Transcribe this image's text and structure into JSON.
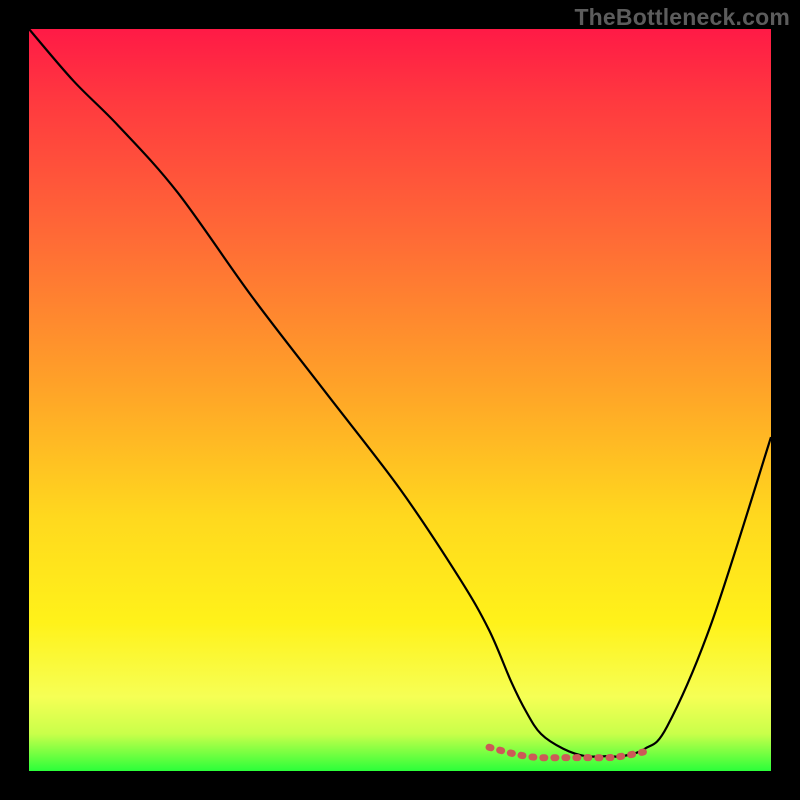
{
  "watermark": "TheBottleneck.com",
  "chart_data": {
    "type": "line",
    "title": "",
    "xlabel": "",
    "ylabel": "",
    "xlim": [
      0,
      100
    ],
    "ylim": [
      0,
      100
    ],
    "series": [
      {
        "name": "black-curve",
        "x": [
          0,
          6,
          12,
          20,
          30,
          40,
          50,
          58,
          62,
          65,
          67,
          69,
          72,
          75,
          78,
          80,
          83,
          86,
          92,
          100
        ],
        "values": [
          100,
          93,
          87,
          78,
          64,
          51,
          38,
          26,
          19,
          12,
          8,
          5,
          3,
          2,
          2,
          2,
          3,
          6,
          20,
          45
        ]
      },
      {
        "name": "red-highlight",
        "x": [
          62,
          65,
          67,
          69,
          72,
          75,
          78,
          80,
          83
        ],
        "values": [
          3.2,
          2.4,
          2.0,
          1.8,
          1.8,
          1.8,
          1.8,
          2.0,
          2.6
        ]
      }
    ],
    "colors": {
      "black_curve": "#000000",
      "red_highlight": "#cc5a57",
      "gradient_top": "#ff1a46",
      "gradient_mid1": "#ffa228",
      "gradient_mid2": "#fff21a",
      "gradient_bottom": "#2bff3a"
    }
  }
}
